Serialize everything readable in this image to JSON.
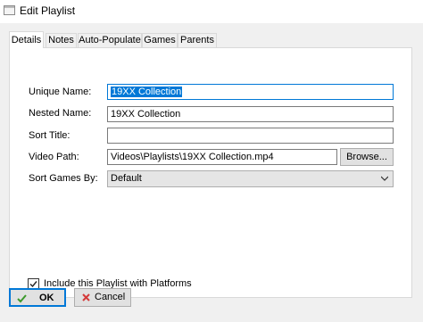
{
  "window": {
    "title": "Edit Playlist",
    "icon": "window-icon"
  },
  "tabs": [
    {
      "label": "Details",
      "active": true
    },
    {
      "label": "Notes",
      "active": false
    },
    {
      "label": "Auto-Populate",
      "active": false
    },
    {
      "label": "Games",
      "active": false
    },
    {
      "label": "Parents",
      "active": false
    }
  ],
  "form": {
    "unique_name": {
      "label": "Unique Name:",
      "value": "19XX Collection"
    },
    "nested_name": {
      "label": "Nested Name:",
      "value": "19XX Collection"
    },
    "sort_title": {
      "label": "Sort Title:",
      "value": ""
    },
    "video_path": {
      "label": "Video Path:",
      "value": "Videos\\Playlists\\19XX Collection.mp4",
      "browse_label": "Browse..."
    },
    "sort_games_by": {
      "label": "Sort Games By:",
      "value": "Default"
    }
  },
  "include_platforms": {
    "label": "Include this Playlist with Platforms",
    "checked": true
  },
  "buttons": {
    "ok": "OK",
    "cancel": "Cancel"
  },
  "colors": {
    "accent": "#0078d7",
    "ok_icon": "#3c9a2c",
    "cancel_icon": "#d43a3a"
  }
}
